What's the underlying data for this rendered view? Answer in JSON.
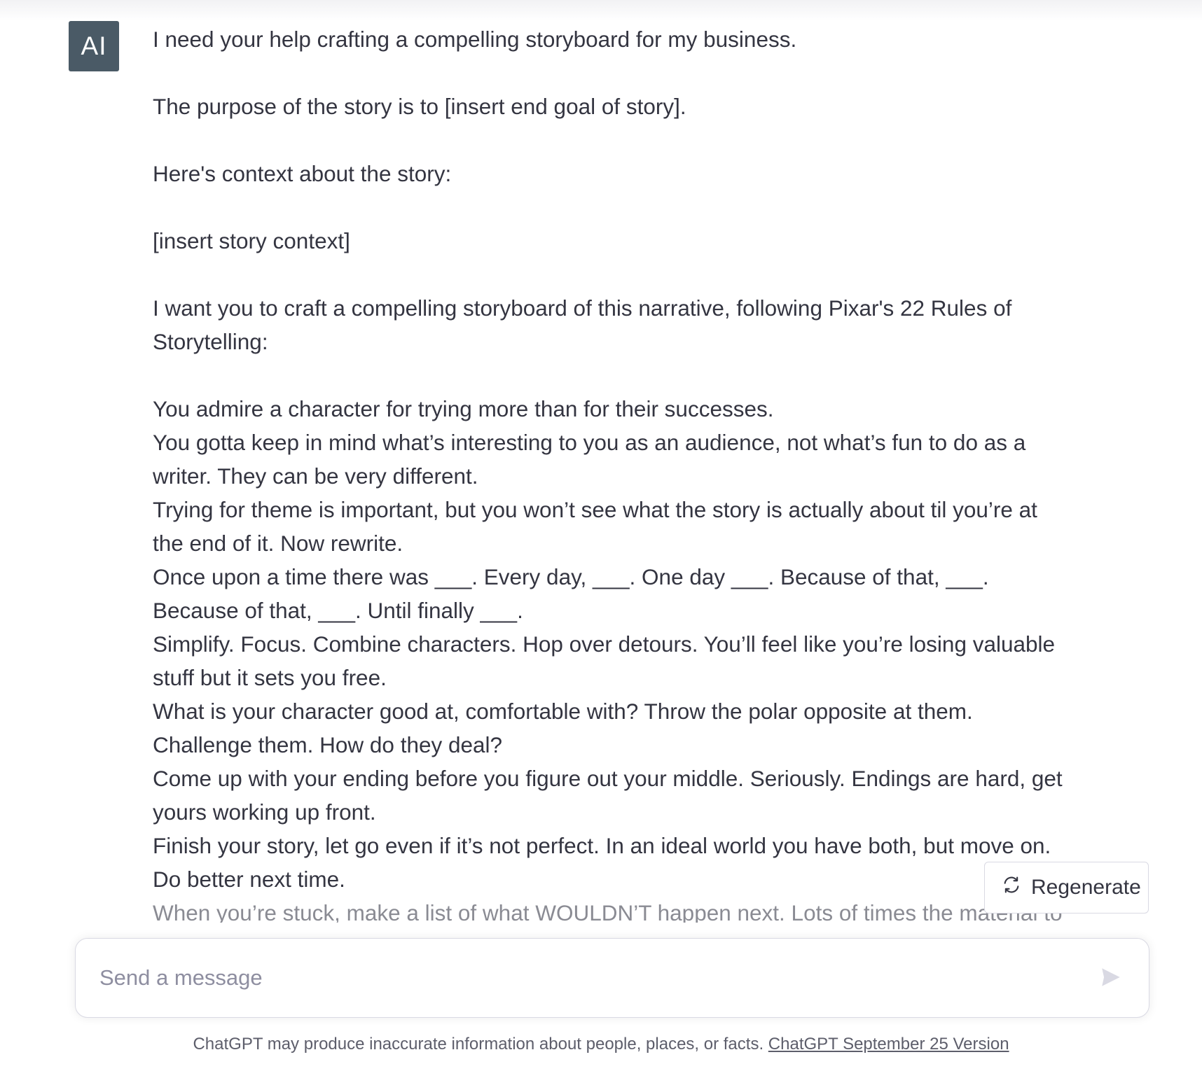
{
  "avatar": {
    "label": "AI"
  },
  "message": {
    "intro": "I need your help crafting a compelling storyboard for my business.",
    "purpose": "The purpose of the story is to [insert end goal of story].",
    "context_label": "Here's context about the story:",
    "context_placeholder": "[insert story context]",
    "instruction": "I want you to craft a compelling storyboard of this narrative, following Pixar's 22 Rules of Storytelling:",
    "rules": [
      "You admire a character for trying more than for their successes.",
      "You gotta keep in mind what’s interesting to you as an audience, not what’s fun to do as a writer. They can be very different.",
      "Trying for theme is important, but you won’t see what the story is actually about til you’re at the end of it. Now rewrite.",
      "Once upon a time there was ___. Every day, ___. One day ___. Because of that, ___. Because of that, ___. Until finally ___.",
      "Simplify. Focus. Combine characters. Hop over detours. You’ll feel like you’re losing valuable stuff but it sets you free.",
      "What is your character good at, comfortable with? Throw the polar opposite at them. Challenge them. How do they deal?",
      "Come up with your ending before you figure out your middle. Seriously. Endings are hard, get yours working up front.",
      "Finish your story, let go even if it’s not perfect. In an ideal world you have both, but move on. Do better next time.",
      "When you’re stuck, make a list of what WOULDN’T happen next. Lots of times the material to"
    ]
  },
  "regenerate": {
    "label": "Regenerate",
    "icon": "refresh-icon"
  },
  "composer": {
    "placeholder": "Send a message",
    "send_icon": "send-icon"
  },
  "footer": {
    "disclaimer": "ChatGPT may produce inaccurate information about people, places, or facts.",
    "version_link": "ChatGPT September 25 Version"
  }
}
